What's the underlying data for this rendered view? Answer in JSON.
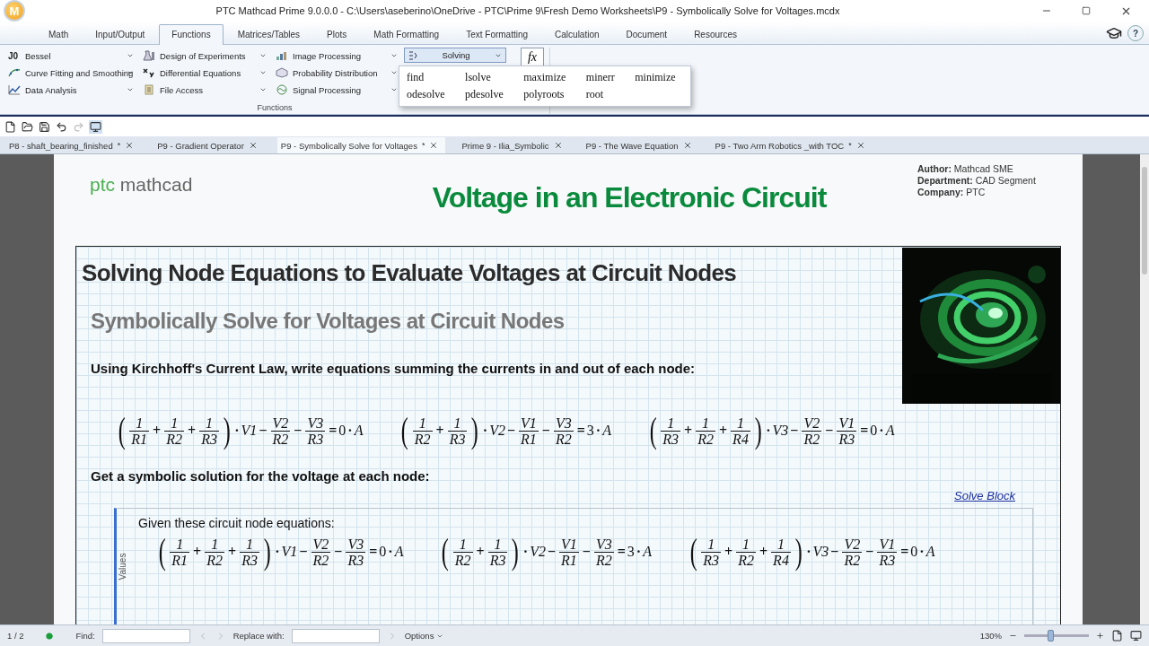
{
  "window": {
    "logo_letter": "M",
    "title": "PTC Mathcad Prime 9.0.0.0 - C:\\Users\\aseberino\\OneDrive - PTC\\Prime 9\\Fresh Demo Worksheets\\P9 - Symbolically Solve for Voltages.mcdx"
  },
  "ribbon": {
    "tabs": [
      {
        "label": "Math",
        "selected": false
      },
      {
        "label": "Input/Output",
        "selected": false
      },
      {
        "label": "Functions",
        "selected": true
      },
      {
        "label": "Matrices/Tables",
        "selected": false
      },
      {
        "label": "Plots",
        "selected": false
      },
      {
        "label": "Math Formatting",
        "selected": false
      },
      {
        "label": "Text Formatting",
        "selected": false
      },
      {
        "label": "Calculation",
        "selected": false
      },
      {
        "label": "Document",
        "selected": false
      },
      {
        "label": "Resources",
        "selected": false
      }
    ],
    "help": "?",
    "columns": [
      [
        {
          "symbol": "J0",
          "label": "Bessel"
        },
        {
          "label": "Curve Fitting and Smoothing"
        },
        {
          "label": "Data Analysis"
        }
      ],
      [
        {
          "label": "Design of Experiments"
        },
        {
          "label": "Differential Equations"
        },
        {
          "label": "File Access"
        }
      ],
      [
        {
          "label": "Image Processing"
        },
        {
          "label": "Probability Distribution"
        },
        {
          "label": "Signal Processing"
        }
      ]
    ],
    "solving": {
      "label": "Solving",
      "expanded": true,
      "items": [
        "find",
        "lsolve",
        "maximize",
        "minerr",
        "minimize",
        "odesolve",
        "pdesolve",
        "polyroots",
        "root"
      ]
    },
    "function_button": "fx",
    "group_label": "Functions"
  },
  "quick_access": [
    {
      "disabled": false
    },
    {
      "disabled": false
    },
    {
      "disabled": false
    },
    {
      "disabled": false
    },
    {
      "disabled": true
    },
    {
      "disabled": false
    }
  ],
  "doc_tabs": [
    {
      "label": "P8 - shaft_bearing_finished",
      "mark": "*",
      "selected": false
    },
    {
      "label": "P9 - Gradient Operator",
      "selected": false
    },
    {
      "label": "P9 - Symbolically Solve for Voltages",
      "mark": "*",
      "selected": true
    },
    {
      "label": "Prime 9 - Ilia_Symbolic",
      "selected": false
    },
    {
      "label": "P9 - The Wave Equation",
      "selected": false
    },
    {
      "label": "P9 - Two Arm Robotics _with TOC",
      "mark": "*",
      "selected": false
    }
  ],
  "worksheet": {
    "logo": {
      "brand": "ptc",
      "product": "mathcad"
    },
    "title": "Voltage in an Electronic Circuit",
    "info": [
      {
        "label": "Author:",
        "value": "Mathcad SME"
      },
      {
        "label": "Department:",
        "value": "CAD Segment"
      },
      {
        "label": "Company:",
        "value": "PTC"
      }
    ],
    "heading": "Solving Node Equations to Evaluate Voltages at Circuit Nodes",
    "subheading": "Symbolically Solve for Voltages at Circuit Nodes",
    "instruction": "Using Kirchhoff's Current Law, write equations summing the currents in and out of each node:",
    "equations": [
      [
        {
          "kind": "paren",
          "text": "("
        },
        {
          "kind": "frac",
          "num": "1",
          "den": "R1"
        },
        {
          "kind": "op",
          "text": "+"
        },
        {
          "kind": "frac",
          "num": "1",
          "den": "R2"
        },
        {
          "kind": "op",
          "text": "+"
        },
        {
          "kind": "frac",
          "num": "1",
          "den": "R3"
        },
        {
          "kind": "paren",
          "text": ")"
        },
        {
          "kind": "op",
          "text": "·"
        },
        {
          "kind": "var",
          "text": "V1"
        },
        {
          "kind": "op",
          "text": "−"
        },
        {
          "kind": "frac",
          "num": "V2",
          "den": "R2"
        },
        {
          "kind": "op",
          "text": "−"
        },
        {
          "kind": "frac",
          "num": "V3",
          "den": "R3"
        },
        {
          "kind": "op",
          "text": "="
        },
        {
          "kind": "num",
          "text": "0"
        },
        {
          "kind": "op",
          "text": "·"
        },
        {
          "kind": "var",
          "text": "A"
        }
      ],
      [
        {
          "kind": "paren",
          "text": "("
        },
        {
          "kind": "frac",
          "num": "1",
          "den": "R2"
        },
        {
          "kind": "op",
          "text": "+"
        },
        {
          "kind": "frac",
          "num": "1",
          "den": "R3"
        },
        {
          "kind": "paren",
          "text": ")"
        },
        {
          "kind": "op",
          "text": "·"
        },
        {
          "kind": "var",
          "text": "V2"
        },
        {
          "kind": "op",
          "text": "−"
        },
        {
          "kind": "frac",
          "num": "V1",
          "den": "R1"
        },
        {
          "kind": "op",
          "text": "−"
        },
        {
          "kind": "frac",
          "num": "V3",
          "den": "R2"
        },
        {
          "kind": "op",
          "text": "="
        },
        {
          "kind": "num",
          "text": "3"
        },
        {
          "kind": "op",
          "text": "·"
        },
        {
          "kind": "var",
          "text": "A"
        }
      ],
      [
        {
          "kind": "paren",
          "text": "("
        },
        {
          "kind": "frac",
          "num": "1",
          "den": "R3"
        },
        {
          "kind": "op",
          "text": "+"
        },
        {
          "kind": "frac",
          "num": "1",
          "den": "R2"
        },
        {
          "kind": "op",
          "text": "+"
        },
        {
          "kind": "frac",
          "num": "1",
          "den": "R4"
        },
        {
          "kind": "paren",
          "text": ")"
        },
        {
          "kind": "op",
          "text": "·"
        },
        {
          "kind": "var",
          "text": "V3"
        },
        {
          "kind": "op",
          "text": "−"
        },
        {
          "kind": "frac",
          "num": "V2",
          "den": "R2"
        },
        {
          "kind": "op",
          "text": "−"
        },
        {
          "kind": "frac",
          "num": "V1",
          "den": "R3"
        },
        {
          "kind": "op",
          "text": "="
        },
        {
          "kind": "num",
          "text": "0"
        },
        {
          "kind": "op",
          "text": "·"
        },
        {
          "kind": "var",
          "text": "A"
        }
      ]
    ],
    "prompt": "Get a symbolic solution for the voltage at each node:",
    "solve_block": {
      "link": "Solve Block",
      "side_label": "Values",
      "intro": "Given these circuit node equations:",
      "equations": [
        [
          {
            "kind": "paren",
            "text": "("
          },
          {
            "kind": "frac",
            "num": "1",
            "den": "R1"
          },
          {
            "kind": "op",
            "text": "+"
          },
          {
            "kind": "frac",
            "num": "1",
            "den": "R2"
          },
          {
            "kind": "op",
            "text": "+"
          },
          {
            "kind": "frac",
            "num": "1",
            "den": "R3"
          },
          {
            "kind": "paren",
            "text": ")"
          },
          {
            "kind": "op",
            "text": "·"
          },
          {
            "kind": "var",
            "text": "V1"
          },
          {
            "kind": "op",
            "text": "−"
          },
          {
            "kind": "frac",
            "num": "V2",
            "den": "R2"
          },
          {
            "kind": "op",
            "text": "−"
          },
          {
            "kind": "frac",
            "num": "V3",
            "den": "R3"
          },
          {
            "kind": "op",
            "text": "="
          },
          {
            "kind": "num",
            "text": "0"
          },
          {
            "kind": "op",
            "text": "·"
          },
          {
            "kind": "var",
            "text": "A"
          }
        ],
        [
          {
            "kind": "paren",
            "text": "("
          },
          {
            "kind": "frac",
            "num": "1",
            "den": "R2"
          },
          {
            "kind": "op",
            "text": "+"
          },
          {
            "kind": "frac",
            "num": "1",
            "den": "R3"
          },
          {
            "kind": "paren",
            "text": ")"
          },
          {
            "kind": "op",
            "text": "·"
          },
          {
            "kind": "var",
            "text": "V2"
          },
          {
            "kind": "op",
            "text": "−"
          },
          {
            "kind": "frac",
            "num": "V1",
            "den": "R1"
          },
          {
            "kind": "op",
            "text": "−"
          },
          {
            "kind": "frac",
            "num": "V3",
            "den": "R2"
          },
          {
            "kind": "op",
            "text": "="
          },
          {
            "kind": "num",
            "text": "3"
          },
          {
            "kind": "op",
            "text": "·"
          },
          {
            "kind": "var",
            "text": "A"
          }
        ],
        [
          {
            "kind": "paren",
            "text": "("
          },
          {
            "kind": "frac",
            "num": "1",
            "den": "R3"
          },
          {
            "kind": "op",
            "text": "+"
          },
          {
            "kind": "frac",
            "num": "1",
            "den": "R2"
          },
          {
            "kind": "op",
            "text": "+"
          },
          {
            "kind": "frac",
            "num": "1",
            "den": "R4"
          },
          {
            "kind": "paren",
            "text": ")"
          },
          {
            "kind": "op",
            "text": "·"
          },
          {
            "kind": "var",
            "text": "V3"
          },
          {
            "kind": "op",
            "text": "−"
          },
          {
            "kind": "frac",
            "num": "V2",
            "den": "R2"
          },
          {
            "kind": "op",
            "text": "−"
          },
          {
            "kind": "frac",
            "num": "V1",
            "den": "R3"
          },
          {
            "kind": "op",
            "text": "="
          },
          {
            "kind": "num",
            "text": "0"
          },
          {
            "kind": "op",
            "text": "·"
          },
          {
            "kind": "var",
            "text": "A"
          }
        ]
      ]
    }
  },
  "status_bar": {
    "page": "1 / 2",
    "find_label": "Find:",
    "replace_label": "Replace with:",
    "options": "Options",
    "zoom": "130%",
    "zoom_slider": {
      "level": 0.4
    }
  }
}
